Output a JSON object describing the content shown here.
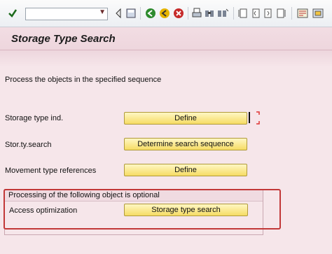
{
  "toolbar": {
    "command_field_value": "",
    "icons": [
      "enter-icon",
      "back-icon",
      "save-icon",
      "green-back-icon",
      "exit-icon",
      "cancel-icon",
      "print-icon",
      "find-icon",
      "find-next-icon",
      "first-page-icon",
      "prev-page-icon",
      "next-page-icon",
      "last-page-icon",
      "create-session-icon",
      "shortcut-icon"
    ]
  },
  "title": "Storage Type Search",
  "instruction": "Process the objects in the specified sequence",
  "rows": [
    {
      "label": "Storage type ind.",
      "button": "Define"
    },
    {
      "label": "Stor.ty.search",
      "button": "Determine search sequence"
    },
    {
      "label": "Movement type references",
      "button": "Define"
    }
  ],
  "optional_section": {
    "header": "Processing of the following object is optional",
    "label": "Access optimization",
    "button": "Storage type search"
  },
  "colors": {
    "background": "#f6e6ea",
    "button": "#f6dc64",
    "highlight": "#c23838"
  }
}
